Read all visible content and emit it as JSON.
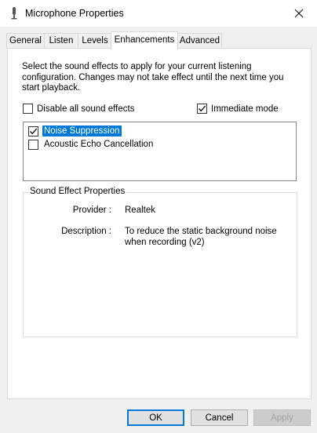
{
  "window": {
    "title": "Microphone Properties"
  },
  "tabs": [
    {
      "label": "General"
    },
    {
      "label": "Listen"
    },
    {
      "label": "Levels"
    },
    {
      "label": "Enhancements"
    },
    {
      "label": "Advanced"
    }
  ],
  "enhancements": {
    "description": "Select the sound effects to apply for your current listening configuration. Changes may not take effect until the next time you start playback.",
    "disable_all": {
      "label": "Disable all sound effects",
      "checked": false
    },
    "immediate_mode": {
      "label": "Immediate mode",
      "checked": true
    },
    "effects": [
      {
        "label": "Noise Suppression",
        "checked": true,
        "selected": true
      },
      {
        "label": "Acoustic Echo Cancellation",
        "checked": false,
        "selected": false
      }
    ],
    "properties": {
      "group_title": "Sound Effect Properties",
      "provider_label": "Provider :",
      "provider_value": "Realtek",
      "description_label": "Description :",
      "description_value": "To reduce the static background noise when recording (v2)"
    }
  },
  "buttons": {
    "ok": "OK",
    "cancel": "Cancel",
    "apply": "Apply"
  },
  "colors": {
    "selection": "#0078d7",
    "default_button_border": "#0078d7"
  }
}
